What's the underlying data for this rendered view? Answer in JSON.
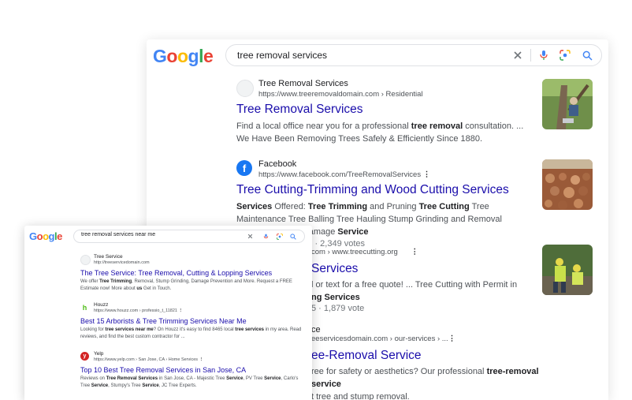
{
  "back": {
    "query": "tree removal services",
    "results": [
      {
        "site": "Tree Removal Services",
        "url": "https://www.treeremovaldomain.com › Residential",
        "title": "Tree Removal Services",
        "snippet_a": "Find a local office near you for a professional ",
        "snippet_b": "tree removal",
        "snippet_c": " consultation. ... We Have Been Removing Trees Safely & Efficiently Since 1880."
      },
      {
        "site": "Facebook",
        "url": "https://www.facebook.com/TreeRemovalServices",
        "title": "Tree Cutting-Trimming and Wood Cutting Services",
        "snippet_a": "Services",
        "snippet_b": " Offered: ",
        "snippet_c": "Tree Trimming",
        "snippet_d": " and Pruning ",
        "snippet_e": "Tree Cutting",
        "snippet_f": " Tree Maintenance Tree Balling Tree Hauling Stump Grinding and Removal Emergency Tree Damage ",
        "snippet_g": "Service",
        "rating": "Rating: 5 · 2,349 votes"
      },
      {
        "url": "com › www.treecutting.org",
        "title": "Services",
        "snippet_a": "l or text for a free quote! ... Tree Cutting with Permit in",
        "snippet_b": "ng Services",
        "rating": "5 · 1,879 vote"
      },
      {
        "site": "ce",
        "url": "eeservicesdomain.com › our-services › ...",
        "title": "ee-Removal Service",
        "snippet_a": "ree for safety or aesthetics? Our professional ",
        "snippet_b": "tree-removal service",
        "snippet_c": "t tree and stump removal."
      }
    ]
  },
  "front": {
    "query": "tree removal services near me",
    "results": [
      {
        "site": "Tree Service",
        "url": "http://treeservicedomain.com",
        "title": "The Tree Service: Tree Removal, Cutting & Lopping Services",
        "snippet_a": "We offer ",
        "snippet_b": "Tree Trimming",
        "snippet_c": ", Removal, Stump Grinding, Damage Prevention and More. Request a FREE Estimate now! More about ",
        "snippet_d": "us",
        "snippet_e": " Get in Touch."
      },
      {
        "site": "Houzz",
        "url": "https://www.houzz.com › professio_t_11821",
        "title": "Best 15 Arborists & Tree Trimming Services Near Me",
        "snippet_a": "Looking for ",
        "snippet_b": "tree services near me",
        "snippet_c": "? On Houzz it's easy to find 8465 local ",
        "snippet_d": "tree services",
        "snippet_e": " in my area. Read reviews, and find the best custom contractor for ..."
      },
      {
        "site": "Yelp",
        "url": "https://www.yelp.com › San Jose, CA › Home Services",
        "title": "Top 10 Best Tree Removal Services in San Jose, CA",
        "snippet_a": "Reviews on ",
        "snippet_b": "Tree Removal Services",
        "snippet_c": " in San Jose, CA - Majestic Tree ",
        "snippet_d": "Service",
        "snippet_e": ", PV Tree ",
        "snippet_f": "Service",
        "snippet_g": ", Carlo's Tree ",
        "snippet_h": "Service",
        "snippet_i": ", Stumpy's Tree ",
        "snippet_j": "Service",
        "snippet_k": ", JC Tree Experts."
      }
    ]
  },
  "logo": {
    "l1": "G",
    "l2": "o",
    "l3": "o",
    "l4": "g",
    "l5": "l",
    "l6": "e"
  },
  "colors": {
    "link": "#1a0dab",
    "snippet": "#4d5156",
    "star": "#fbbc05",
    "facebook": "#1877f2",
    "houzz": "#4dbc15",
    "yelp": "#d32323"
  },
  "icons": [
    "clear-icon",
    "mic-icon",
    "lens-icon",
    "search-icon",
    "more-icon"
  ]
}
